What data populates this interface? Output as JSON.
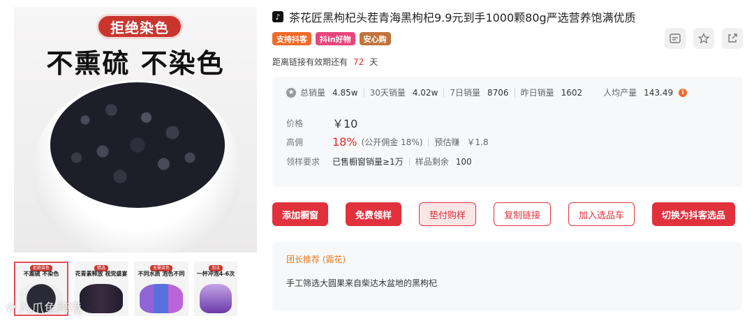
{
  "image": {
    "badge": "拒绝染色",
    "headline": "不熏硫 不染色"
  },
  "thumbnails": [
    {
      "tag": "拒绝染色",
      "text": "不熏硫 不染色"
    },
    {
      "tag": "精选",
      "text": "花青素释放 视觉盛宴"
    },
    {
      "tag": "无需染色",
      "text": "不同水质 泡色不同"
    },
    {
      "tag": "泡法",
      "text": "一杯冲泡4-6次"
    }
  ],
  "watermark": "八爪鱼跨境",
  "product": {
    "platform_icon": "♪",
    "title": "茶花匠黑枸杞头茬青海黑枸杞9.9元到手1000颗80g严选营养饱满优质",
    "tags": [
      "支持抖客",
      "抖in好物",
      "安心购"
    ],
    "validity_prefix": "距离链接有效期还有",
    "validity_days": "72",
    "validity_suffix": "天"
  },
  "stats": {
    "total_sales_label": "总销量",
    "total_sales": "4.85w",
    "sales_30d_label": "30天销量",
    "sales_30d": "4.02w",
    "sales_7d_label": "7日销量",
    "sales_7d": "8706",
    "sales_yesterday_label": "昨日销量",
    "sales_yesterday": "1602",
    "per_capita_label": "人均产量",
    "per_capita": "143.49",
    "price_label": "价格",
    "price": "￥10",
    "commission_label": "高佣",
    "commission_rate": "18%",
    "public_commission": "(公开佣金 18%)",
    "estimated_label": "预估赚",
    "estimated": "￥1.8",
    "sample_req_label": "领样要求",
    "sample_req": "已售橱窗销量≥1万",
    "sample_left_label": "样品剩余",
    "sample_left": "100"
  },
  "actions": [
    "添加橱窗",
    "免费领样",
    "垫付购样",
    "复制链接",
    "加入选品车",
    "切换为抖客选品"
  ],
  "recommend": {
    "title": "团长推荐 (霜花)",
    "text": "手工筛选大圆果来自柴达木盆地的黑枸杞"
  },
  "colors": {
    "accent": "#e0313d",
    "orange": "#f06a2a"
  }
}
